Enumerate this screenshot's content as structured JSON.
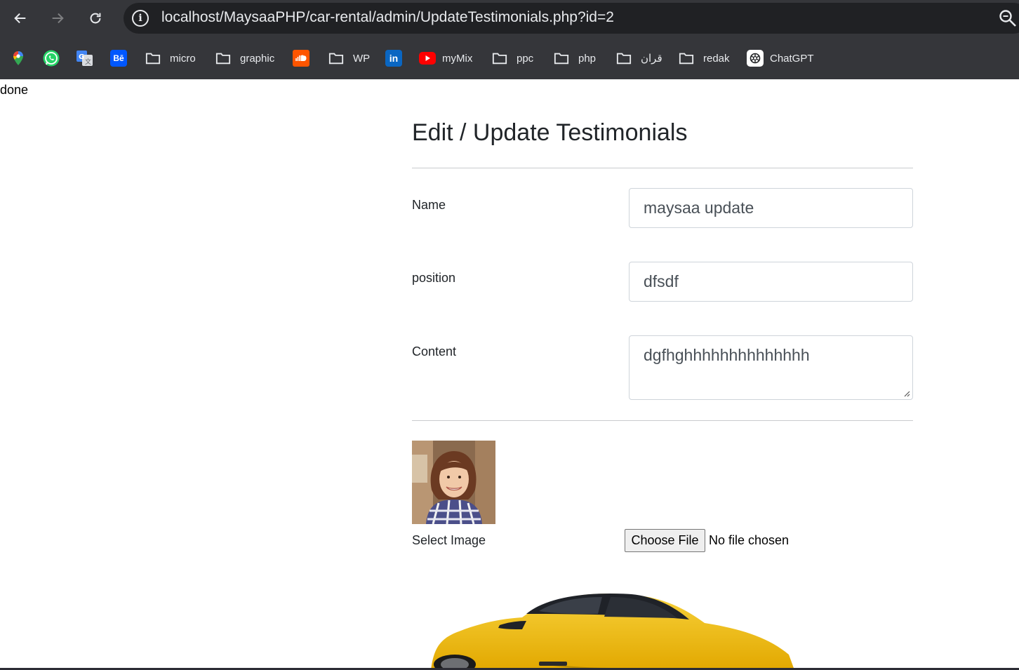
{
  "browser": {
    "url": "localhost/MaysaaPHP/car-rental/admin/UpdateTestimonials.php?id=2",
    "bookmarks": [
      {
        "label": "",
        "icon": "google-maps-icon"
      },
      {
        "label": "",
        "icon": "whatsapp-icon"
      },
      {
        "label": "",
        "icon": "google-translate-icon"
      },
      {
        "label": "",
        "icon": "behance-icon"
      },
      {
        "label": "micro",
        "icon": "folder-icon"
      },
      {
        "label": "graphic",
        "icon": "folder-icon"
      },
      {
        "label": "",
        "icon": "soundcloud-icon"
      },
      {
        "label": "WP",
        "icon": "folder-icon"
      },
      {
        "label": "",
        "icon": "linkedin-icon"
      },
      {
        "label": "myMix",
        "icon": "youtube-icon"
      },
      {
        "label": "ppc",
        "icon": "folder-icon"
      },
      {
        "label": "php",
        "icon": "folder-icon"
      },
      {
        "label": "قران",
        "icon": "folder-icon"
      },
      {
        "label": "redak",
        "icon": "folder-icon"
      },
      {
        "label": "ChatGPT",
        "icon": "chatgpt-icon"
      }
    ]
  },
  "page": {
    "status_message": "done",
    "title": "Edit / Update Testimonials",
    "form": {
      "name": {
        "label": "Name",
        "value": "maysaa update"
      },
      "position": {
        "label": "position",
        "value": "dfsdf"
      },
      "content": {
        "label": "Content",
        "value": "dgfhghhhhhhhhhhhhhh"
      },
      "image": {
        "label": "Select Image",
        "button": "Choose File",
        "status": "No file chosen"
      }
    }
  },
  "colors": {
    "chrome_bg": "#35363a",
    "omnibox_bg": "#202124",
    "text_dark": "#212529"
  }
}
